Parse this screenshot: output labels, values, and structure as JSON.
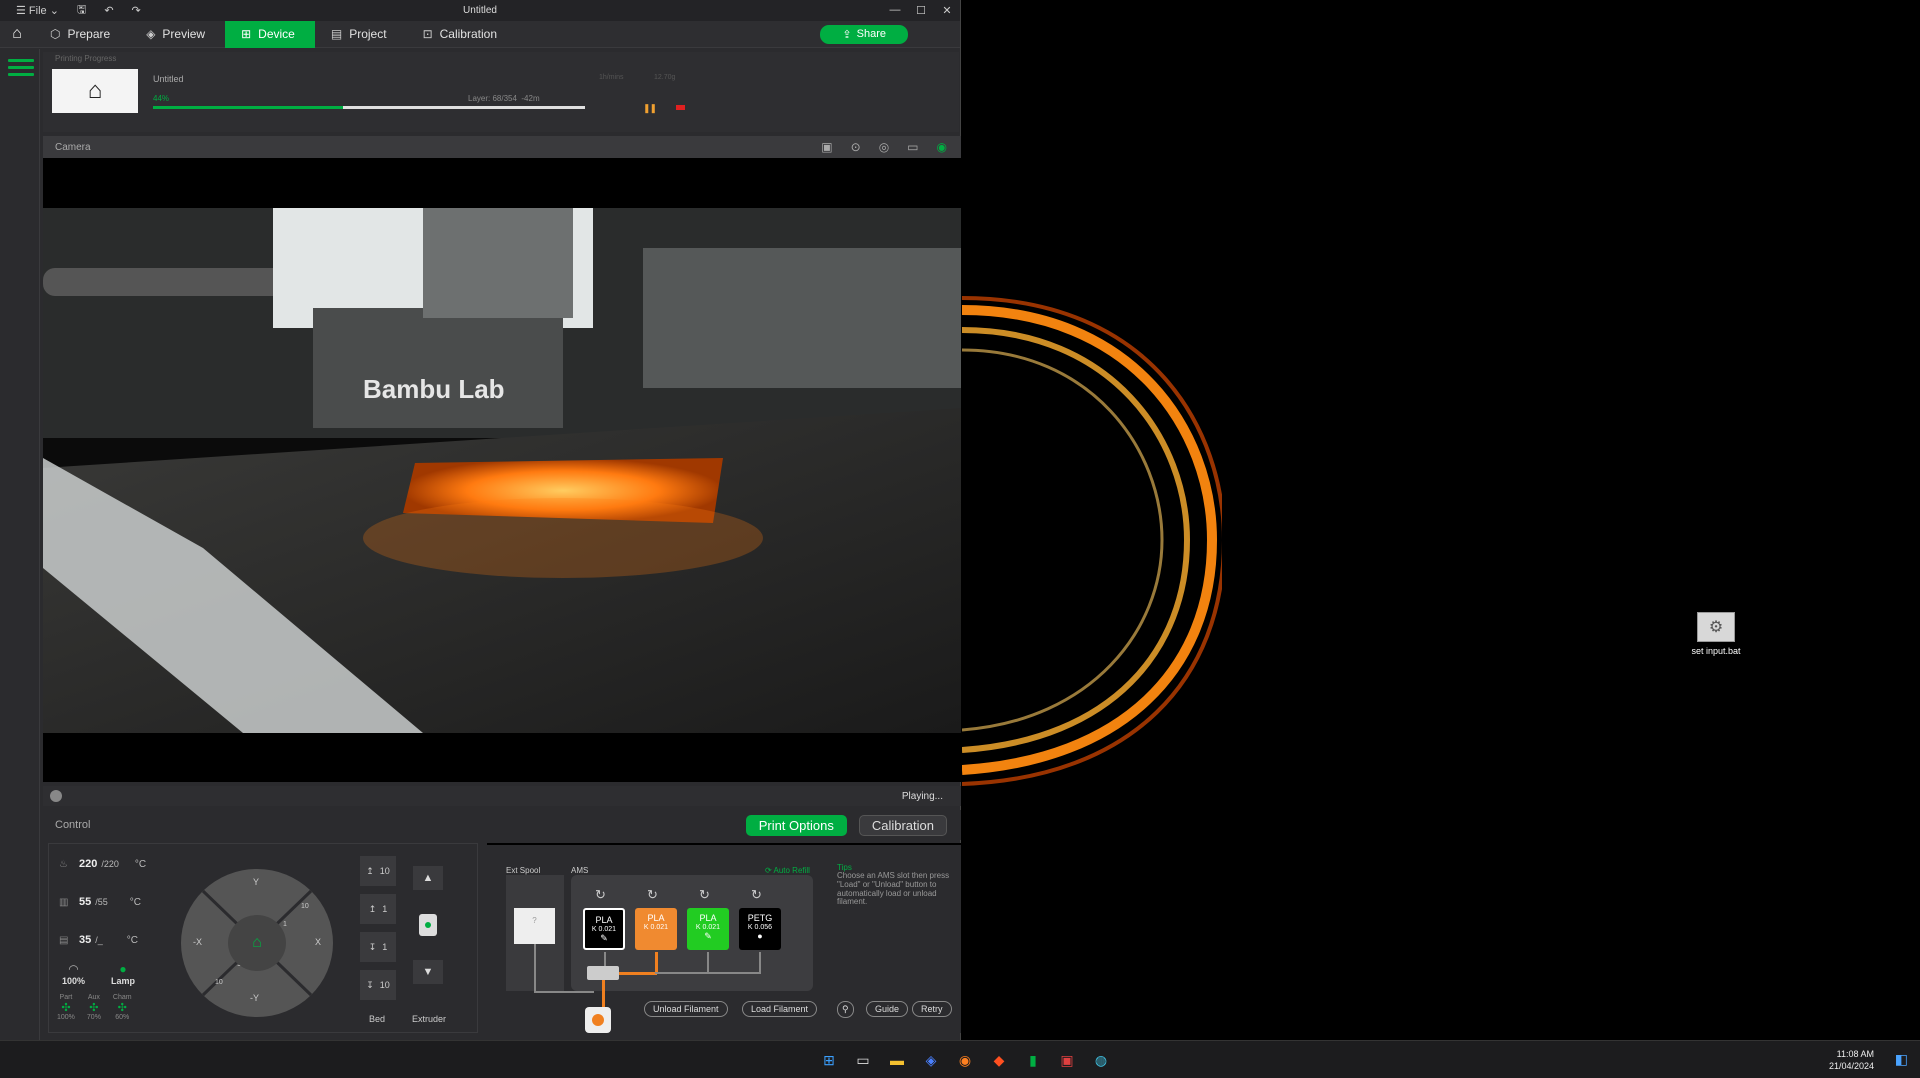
{
  "titlebar": {
    "file_label": "File",
    "title": "Untitled"
  },
  "tabs": [
    {
      "label": "Prepare",
      "icon": "cube-icon"
    },
    {
      "label": "Preview",
      "icon": "layers-icon"
    },
    {
      "label": "Device",
      "icon": "device-icon"
    },
    {
      "label": "Project",
      "icon": "project-icon"
    },
    {
      "label": "Calibration",
      "icon": "calibration-icon"
    }
  ],
  "share_label": "Share",
  "progress": {
    "header": "Printing Progress",
    "name": "Untitled",
    "percent_text": "44%",
    "percent": 44,
    "layer_text": "Layer: 68/354",
    "remaining": "-42m",
    "info_left": "1h/mins",
    "info_right": "12.70g"
  },
  "camera": {
    "label": "Camera",
    "status": "Playing..."
  },
  "control": {
    "label": "Control",
    "print_options": "Print Options",
    "calibration": "Calibration",
    "nozzle_temp": "220",
    "nozzle_target": "/220",
    "bed_temp": "55",
    "bed_target": "/55",
    "chamber_temp": "35",
    "chamber_target": "/_",
    "unit": "°C",
    "speed": "100%",
    "lamp": "Lamp",
    "fans": [
      {
        "label": "Part",
        "value": "100%"
      },
      {
        "label": "Aux",
        "value": "70%"
      },
      {
        "label": "Cham",
        "value": "60%"
      }
    ],
    "joystick": {
      "y_up": "Y",
      "y_down": "-Y",
      "x_left": "-X",
      "x_right": "X",
      "n10a": "10",
      "n1a": "1",
      "n10b": "10",
      "n1b": "1"
    },
    "z_buttons": [
      "10",
      "1",
      "1",
      "10"
    ],
    "bed_label": "Bed",
    "extruder_label": "Extruder"
  },
  "ams": {
    "ext_spool": "Ext Spool",
    "ams_label": "AMS",
    "auto_refill": "Auto Refill",
    "ext_q": "?",
    "slots": [
      {
        "type": "PLA",
        "k": "K 0.021",
        "color": "#000000",
        "text": "#ffffff"
      },
      {
        "type": "PLA",
        "k": "K 0.021",
        "color": "#f08a30",
        "text": "#ffffff"
      },
      {
        "type": "PLA",
        "k": "K 0.021",
        "color": "#22cc22",
        "text": "#ffffff"
      },
      {
        "type": "PETG",
        "k": "K 0.056",
        "color": "#000000",
        "text": "#ffffff"
      }
    ],
    "tips_title": "Tips",
    "tips": "Choose an AMS slot then press \"Load\" or \"Unload\" button to automatically load or unload filament.",
    "unload": "Unload Filament",
    "load": "Load Filament",
    "guide": "Guide",
    "retry": "Retry"
  },
  "desktop": {
    "icon_label": "set input.bat"
  },
  "taskbar": {
    "time": "11:08 AM",
    "date": "21/04/2024"
  },
  "colors": {
    "accent": "#00ae42",
    "stop": "#e02020"
  }
}
